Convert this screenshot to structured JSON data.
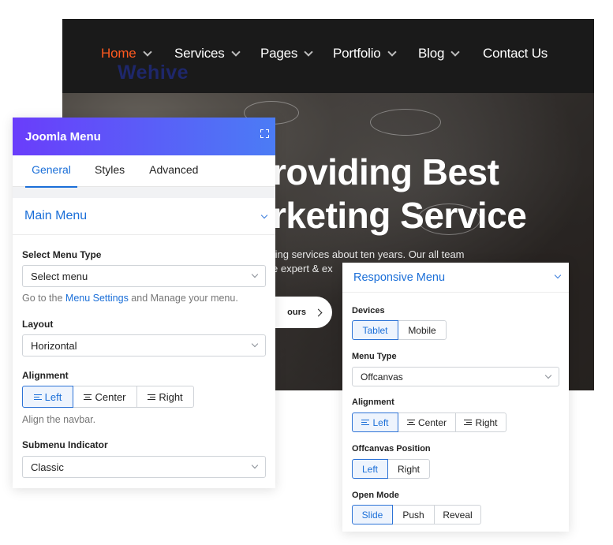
{
  "site": {
    "brand": "Wehive",
    "nav": [
      {
        "label": "Home",
        "active": true,
        "has_dropdown": true
      },
      {
        "label": "Services",
        "active": false,
        "has_dropdown": true
      },
      {
        "label": "Pages",
        "active": false,
        "has_dropdown": true
      },
      {
        "label": "Portfolio",
        "active": false,
        "has_dropdown": true
      },
      {
        "label": "Blog",
        "active": false,
        "has_dropdown": true
      },
      {
        "label": "Contact Us",
        "active": false,
        "has_dropdown": false
      }
    ],
    "hero": {
      "title_line1": "roviding Best",
      "title_line2": "rketing Service",
      "sub_line1": "ting services about ten years. Our all team",
      "sub_line2": "e expert & ex",
      "button_label": "ours"
    },
    "colors": {
      "nav_bg": "#1a1a1a",
      "active": "#ff5a1f"
    }
  },
  "joomla_panel": {
    "title": "Joomla Menu",
    "tabs": [
      "General",
      "Styles",
      "Advanced"
    ],
    "active_tab": "General",
    "section_title": "Main Menu",
    "menu_type_label": "Select Menu Type",
    "menu_type_value": "Select menu",
    "help_prefix": "Go to the ",
    "help_link": "Menu Settings",
    "help_suffix": " and Manage your menu.",
    "layout_label": "Layout",
    "layout_value": "Horizontal",
    "alignment_label": "Alignment",
    "alignment_options": [
      "Left",
      "Center",
      "Right"
    ],
    "alignment_selected": "Left",
    "alignment_help": "Align the navbar.",
    "submenu_label": "Submenu Indicator",
    "submenu_value": "Classic",
    "colors": {
      "header_start": "#6a3dfb",
      "header_end": "#4b7cf5",
      "accent": "#1b6fd8"
    }
  },
  "responsive_panel": {
    "section_title": "Responsive Menu",
    "devices_label": "Devices",
    "devices": [
      "Tablet",
      "Mobile"
    ],
    "devices_selected": "Tablet",
    "menu_type_label": "Menu Type",
    "menu_type_value": "Offcanvas",
    "alignment_label": "Alignment",
    "alignment_options": [
      "Left",
      "Center",
      "Right"
    ],
    "alignment_selected": "Left",
    "offcanvas_label": "Offcanvas Position",
    "offcanvas_options": [
      "Left",
      "Right"
    ],
    "offcanvas_selected": "Left",
    "open_mode_label": "Open Mode",
    "open_mode_options": [
      "Slide",
      "Push",
      "Reveal"
    ],
    "open_mode_selected": "Slide"
  }
}
